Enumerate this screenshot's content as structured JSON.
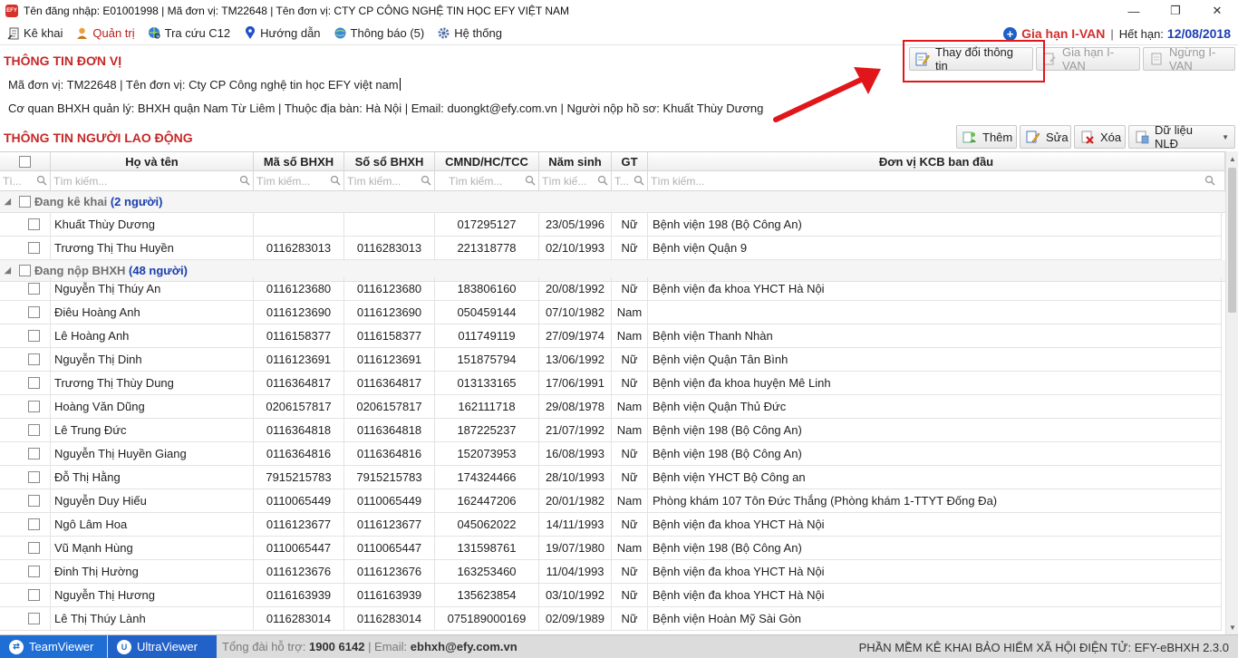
{
  "window": {
    "title": "Tên đăng nhập: E01001998 | Mã đơn vị: TM22648 | Tên đơn vị: CTY CP CÔNG NGHỆ TIN HỌC EFY VIỆT NAM",
    "logo_text": "EFY",
    "minimize": "—",
    "maximize": "❐",
    "close": "✕"
  },
  "menu": {
    "items": [
      {
        "label": "Kê khai",
        "icon": "document-icon"
      },
      {
        "label": "Quản trị",
        "icon": "admin-user-icon"
      },
      {
        "label": "Tra cứu C12",
        "icon": "globe-search-icon"
      },
      {
        "label": "Hướng dẫn",
        "icon": "map-pin-icon"
      },
      {
        "label": "Thông báo (5)",
        "icon": "globe-bell-icon"
      },
      {
        "label": "Hệ thống",
        "icon": "gear-icon"
      }
    ],
    "renew_label": "Gia hạn I-VAN",
    "sep": "|",
    "expiry_label": "Hết hạn:",
    "expiry_date": "12/08/2018"
  },
  "unit": {
    "section_title": "THÔNG TIN ĐƠN VỊ",
    "line1": "Mã đơn vị: TM22648 | Tên đơn vị: Cty CP Công nghệ tin học EFY việt nam",
    "line2": "Cơ quan BHXH quản lý: BHXH quận Nam Từ Liêm | Thuộc địa bàn: Hà Nội | Email: duongkt@efy.com.vn | Người nộp hồ sơ: Khuất Thùy Dương",
    "btn_change": "Thay đổi thông tin",
    "btn_renew": "Gia hạn I-VAN",
    "btn_stop": "Ngừng I-VAN"
  },
  "workers": {
    "section_title": "THÔNG TIN NGƯỜI LAO ĐỘNG",
    "btn_add": "Thêm",
    "btn_edit": "Sửa",
    "btn_delete": "Xóa",
    "btn_data": "Dữ liệu NLĐ",
    "columns": {
      "name": "Họ và tên",
      "ma_so": "Mã số BHXH",
      "so_so": "Số sổ BHXH",
      "cmnd": "CMND/HC/TCC",
      "nam_sinh": "Năm sinh",
      "gt": "GT",
      "kcb": "Đơn vị KCB ban đầu"
    },
    "filters": {
      "first": "Tì...",
      "name": "Tìm kiếm...",
      "ma_so": "Tìm kiếm...",
      "so_so": "Tìm kiếm...",
      "cmnd": "Tìm kiếm...",
      "nam_sinh": "Tìm kiế...",
      "gt": "T...",
      "kcb": "Tìm kiếm..."
    },
    "groups": [
      {
        "label": "Đang kê khai",
        "count": "(2 người)",
        "rows": [
          [
            "Khuất Thùy Dương",
            "",
            "",
            "017295127",
            "23/05/1996",
            "Nữ",
            "Bệnh viện 198 (Bộ Công An)"
          ],
          [
            "Trương Thị Thu Huyền",
            "0116283013",
            "0116283013",
            "221318778",
            "02/10/1993",
            "Nữ",
            "Bệnh viện Quận 9"
          ]
        ]
      },
      {
        "label": "Đang nộp BHXH",
        "count": "(48 người)",
        "rows": [
          [
            "Nguyễn Thị Thúy An",
            "0116123680",
            "0116123680",
            "183806160",
            "20/08/1992",
            "Nữ",
            "Bệnh viện đa khoa YHCT Hà Nội"
          ],
          [
            "Điêu Hoàng Anh",
            "0116123690",
            "0116123690",
            "050459144",
            "07/10/1982",
            "Nam",
            ""
          ],
          [
            "Lê Hoàng Anh",
            "0116158377",
            "0116158377",
            "011749119",
            "27/09/1974",
            "Nam",
            "Bệnh viện Thanh Nhàn"
          ],
          [
            "Nguyễn Thị Dinh",
            "0116123691",
            "0116123691",
            "151875794",
            "13/06/1992",
            "Nữ",
            "Bệnh viện Quận Tân Bình"
          ],
          [
            "Trương Thị Thùy Dung",
            "0116364817",
            "0116364817",
            "013133165",
            "17/06/1991",
            "Nữ",
            "Bệnh viện đa khoa huyện Mê Linh"
          ],
          [
            "Hoàng Văn Dũng",
            "0206157817",
            "0206157817",
            "162111718",
            "29/08/1978",
            "Nam",
            "Bệnh viện Quận Thủ Đức"
          ],
          [
            "Lê Trung Đức",
            "0116364818",
            "0116364818",
            "187225237",
            "21/07/1992",
            "Nam",
            "Bệnh viện 198 (Bộ Công An)"
          ],
          [
            "Nguyễn Thị Huyền Giang",
            "0116364816",
            "0116364816",
            "152073953",
            "16/08/1993",
            "Nữ",
            "Bệnh viện 198 (Bộ Công An)"
          ],
          [
            "Đỗ Thị Hằng",
            "7915215783",
            "7915215783",
            "174324466",
            "28/10/1993",
            "Nữ",
            "Bệnh viện YHCT Bộ Công an"
          ],
          [
            "Nguyễn Duy Hiếu",
            "0110065449",
            "0110065449",
            "162447206",
            "20/01/1982",
            "Nam",
            "Phòng khám 107 Tôn Đức Thắng (Phòng khám  1-TTYT Đống Đa)"
          ],
          [
            "Ngô Lâm Hoa",
            "0116123677",
            "0116123677",
            "045062022",
            "14/11/1993",
            "Nữ",
            "Bệnh viện đa khoa YHCT Hà Nội"
          ],
          [
            "Vũ Mạnh Hùng",
            "0110065447",
            "0110065447",
            "131598761",
            "19/07/1980",
            "Nam",
            "Bệnh viện 198 (Bộ Công An)"
          ],
          [
            "Đinh Thị Hường",
            "0116123676",
            "0116123676",
            "163253460",
            "11/04/1993",
            "Nữ",
            "Bệnh viện đa khoa YHCT Hà Nội"
          ],
          [
            "Nguyễn Thị Hương",
            "0116163939",
            "0116163939",
            "135623854",
            "03/10/1992",
            "Nữ",
            "Bệnh viện đa khoa YHCT Hà Nội"
          ],
          [
            "Lê Thị Thúy Lành",
            "0116283014",
            "0116283014",
            "075189000169",
            "02/09/1989",
            "Nữ",
            "Bệnh viện Hoàn Mỹ Sài Gòn"
          ]
        ]
      }
    ]
  },
  "status": {
    "teamviewer": "TeamViewer",
    "ultraviewer": "UltraViewer",
    "hotline_label": "Tổng đài hỗ trợ:",
    "hotline": "1900 6142",
    "email_label": "| Email:",
    "email": "ebhxh@efy.com.vn",
    "version": "PHẦN MỀM KÊ KHAI BẢO HIỂM XÃ HỘI ĐIỆN TỬ: EFY-eBHXH 2.3.0"
  },
  "colors": {
    "accent_red": "#c62828",
    "link_blue": "#1e3fb4",
    "highlight": "#e0161b"
  }
}
